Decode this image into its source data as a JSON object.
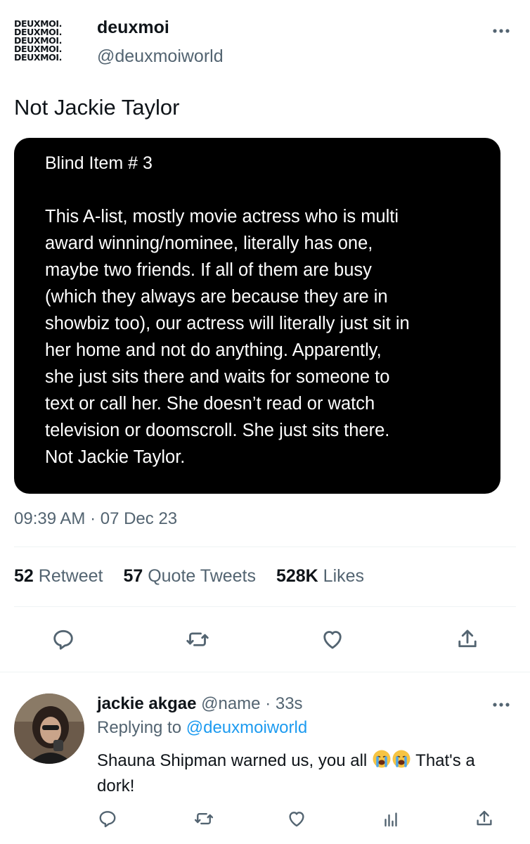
{
  "tweet": {
    "logo_lines": [
      "DEUXMOI.",
      "DEUXMOI.",
      "DEUXMOI.",
      "DEUXMOI.",
      "DEUXMOI."
    ],
    "display_name": "deuxmoi",
    "handle": "@deuxmoiworld",
    "text": "Not Jackie Taylor",
    "card": {
      "title": "Blind Item # 3",
      "lines": [
        "This A-list, mostly movie actress who is multi",
        "award winning/nominee, literally has one,",
        "maybe two friends. If all of them are busy",
        "(which they always are because they are in",
        "showbiz too), our actress will literally just sit in",
        "her home and not do anything. Apparently,",
        "she just sits there and waits for someone to",
        "text or call her. She doesn’t read or watch",
        "television or doomscroll. She just sits there.",
        "Not Jackie Taylor."
      ]
    },
    "timestamp": "09:39 AM · 07 Dec 23",
    "stats": {
      "retweets_count": "52",
      "retweets_label": "Retweet",
      "quotes_count": "57",
      "quotes_label": "Quote Tweets",
      "likes_count": "528K",
      "likes_label": "Likes"
    },
    "actions": [
      "reply-icon",
      "retweet-icon",
      "like-icon",
      "share-icon"
    ]
  },
  "reply": {
    "name": "jackie akgae",
    "handle": "@name",
    "time": "· 33s",
    "replying_prefix": "Replying to",
    "replying_to": "@deuxmoiworld",
    "text_before": "Shauna Shipman warned us, you all",
    "emojis": [
      "loudly-crying-face",
      "loudly-crying-face"
    ],
    "text_after": "That's a dork!",
    "actions": [
      "reply-icon",
      "retweet-icon",
      "like-icon",
      "analytics-icon",
      "share-icon"
    ]
  },
  "colors": {
    "accent": "#1d9bf0",
    "muted": "#536471",
    "text": "#0f1419",
    "card_bg": "#000000"
  }
}
